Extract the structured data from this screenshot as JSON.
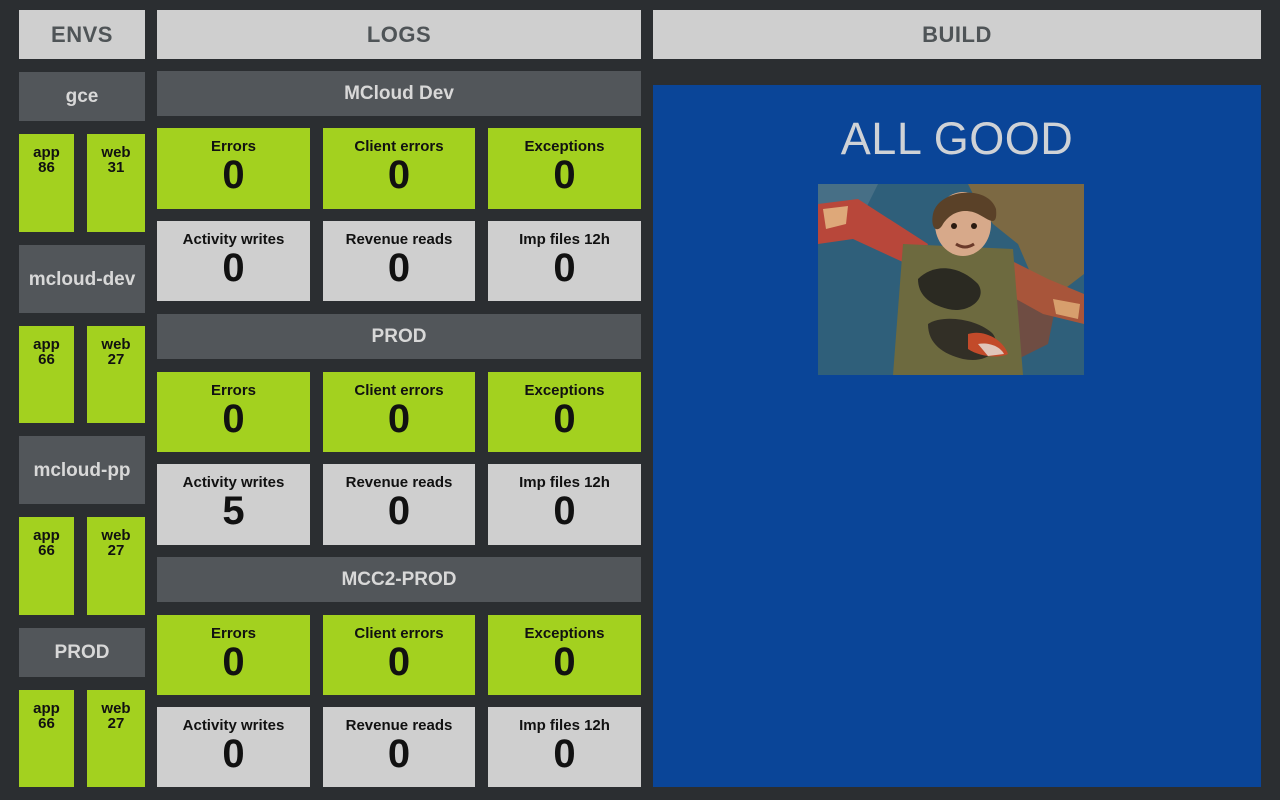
{
  "headers": {
    "envs": "ENVS",
    "logs": "LOGS",
    "build": "BUILD"
  },
  "envs": [
    {
      "name": "gce",
      "app_label": "app",
      "app_value": "86",
      "web_label": "web",
      "web_value": "31"
    },
    {
      "name": "mcloud-dev",
      "app_label": "app",
      "app_value": "66",
      "web_label": "web",
      "web_value": "27"
    },
    {
      "name": "mcloud-pp",
      "app_label": "app",
      "app_value": "66",
      "web_label": "web",
      "web_value": "27"
    },
    {
      "name": "PROD",
      "app_label": "app",
      "app_value": "66",
      "web_label": "web",
      "web_value": "27"
    }
  ],
  "log_sections": [
    {
      "title": "MCloud Dev",
      "metrics": [
        {
          "label": "Errors",
          "value": "0"
        },
        {
          "label": "Client errors",
          "value": "0"
        },
        {
          "label": "Exceptions",
          "value": "0"
        },
        {
          "label": "Activity writes",
          "value": "0"
        },
        {
          "label": "Revenue reads",
          "value": "0"
        },
        {
          "label": "Imp files 12h",
          "value": "0"
        }
      ]
    },
    {
      "title": "PROD",
      "metrics": [
        {
          "label": "Errors",
          "value": "0"
        },
        {
          "label": "Client errors",
          "value": "0"
        },
        {
          "label": "Exceptions",
          "value": "0"
        },
        {
          "label": "Activity writes",
          "value": "5"
        },
        {
          "label": "Revenue reads",
          "value": "0"
        },
        {
          "label": "Imp files 12h",
          "value": "0"
        }
      ]
    },
    {
      "title": "MCC2-PROD",
      "metrics": [
        {
          "label": "Errors",
          "value": "0"
        },
        {
          "label": "Client errors",
          "value": "0"
        },
        {
          "label": "Exceptions",
          "value": "0"
        },
        {
          "label": "Activity writes",
          "value": "0"
        },
        {
          "label": "Revenue reads",
          "value": "0"
        },
        {
          "label": "Imp files 12h",
          "value": "0"
        }
      ]
    }
  ],
  "build": {
    "status": "ALL GOOD",
    "image": "celebration-gif"
  },
  "colors": {
    "background": "#2b2e31",
    "header": "#cfcfcf",
    "env_name_bg": "#52565a",
    "ok_green": "#a3d11f",
    "neutral_gray": "#cfcfcf",
    "build_blue": "#0a4598"
  }
}
